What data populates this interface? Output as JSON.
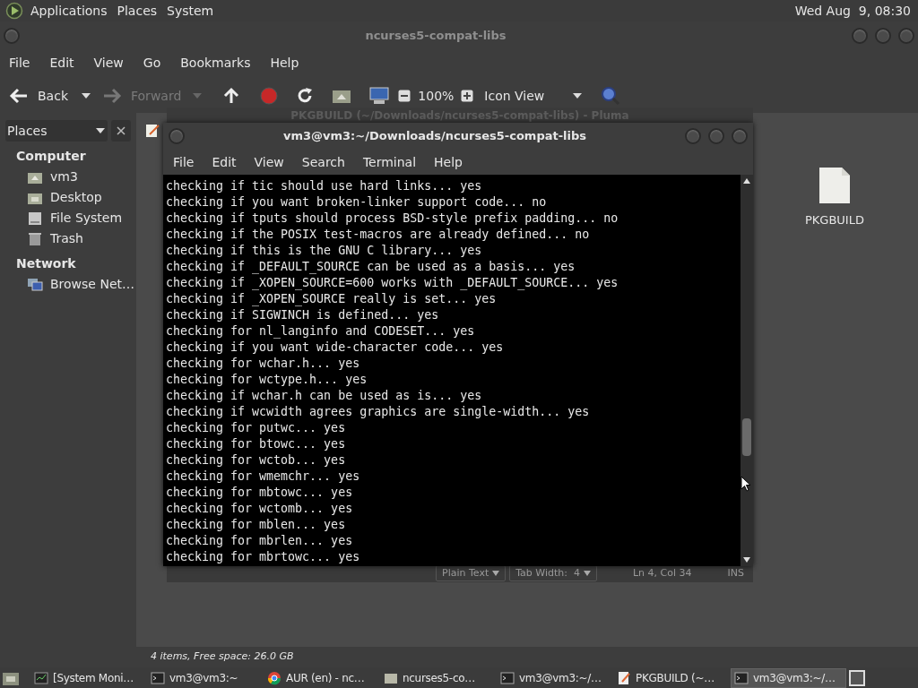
{
  "top_panel": {
    "menus": [
      "Applications",
      "Places",
      "System"
    ],
    "clock": "Wed Aug  9, 08:30"
  },
  "file_manager": {
    "title": "ncurses5-compat-libs",
    "menu": [
      "File",
      "Edit",
      "View",
      "Go",
      "Bookmarks",
      "Help"
    ],
    "toolbar": {
      "back": "Back",
      "forward": "Forward",
      "forward_disabled": true,
      "zoom": "100%",
      "view": "Icon View"
    },
    "sidebar": {
      "title": "Places",
      "sections": [
        {
          "heading": "Computer",
          "items": [
            {
              "label": "vm3",
              "kind": "home"
            },
            {
              "label": "Desktop",
              "kind": "desktop"
            },
            {
              "label": "File System",
              "kind": "drive"
            },
            {
              "label": "Trash",
              "kind": "trash"
            }
          ]
        },
        {
          "heading": "Network",
          "items": [
            {
              "label": "Browse Net…",
              "kind": "network"
            }
          ]
        }
      ]
    },
    "files": [
      {
        "name": "PKGBUILD"
      }
    ],
    "status": "4 items, Free space: 26.0 GB"
  },
  "editor": {
    "title": "PKGBUILD (~/Downloads/ncurses5-compat-libs) - Pluma",
    "status": {
      "language": "Plain Text",
      "tab_width": "Tab Width:  4",
      "position": "Ln 4, Col 34",
      "mode": "INS"
    }
  },
  "terminal": {
    "title": "vm3@vm3:~/Downloads/ncurses5-compat-libs",
    "menu": [
      "File",
      "Edit",
      "View",
      "Search",
      "Terminal",
      "Help"
    ],
    "lines": [
      "checking if tic should use hard links... yes",
      "checking if you want broken-linker support code... no",
      "checking if tputs should process BSD-style prefix padding... no",
      "checking if the POSIX test-macros are already defined... no",
      "checking if this is the GNU C library... yes",
      "checking if _DEFAULT_SOURCE can be used as a basis... yes",
      "checking if _XOPEN_SOURCE=600 works with _DEFAULT_SOURCE... yes",
      "checking if _XOPEN_SOURCE really is set... yes",
      "checking if SIGWINCH is defined... yes",
      "checking for nl_langinfo and CODESET... yes",
      "checking if you want wide-character code... yes",
      "checking for wchar.h... yes",
      "checking for wctype.h... yes",
      "checking if wchar.h can be used as is... yes",
      "checking if wcwidth agrees graphics are single-width... yes",
      "checking for putwc... yes",
      "checking for btowc... yes",
      "checking for wctob... yes",
      "checking for wmemchr... yes",
      "checking for mbtowc... yes",
      "checking for wctomb... yes",
      "checking for mblen... yes",
      "checking for mbrlen... yes",
      "checking for mbrtowc... yes"
    ]
  },
  "taskbar": [
    {
      "label": "[System Moni…",
      "kind": "monitor",
      "selected": false
    },
    {
      "label": "vm3@vm3:~",
      "kind": "terminal",
      "selected": false
    },
    {
      "label": "AUR (en) - nc…",
      "kind": "browser",
      "selected": false
    },
    {
      "label": "ncurses5-co…",
      "kind": "folder",
      "selected": false
    },
    {
      "label": "vm3@vm3:~/…",
      "kind": "terminal",
      "selected": false
    },
    {
      "label": "PKGBUILD (~…",
      "kind": "editor",
      "selected": false
    },
    {
      "label": "vm3@vm3:~/…",
      "kind": "terminal",
      "selected": true
    }
  ]
}
